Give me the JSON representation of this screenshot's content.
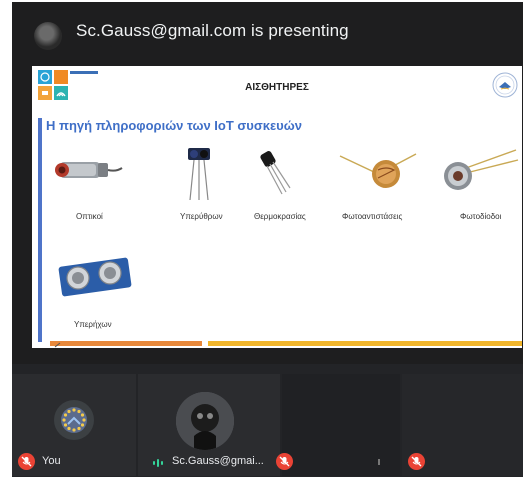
{
  "presenter": {
    "label": "Sc.Gauss@gmail.com is presenting"
  },
  "slide": {
    "title": "ΑΙΣΘΗΤΗΡΕΣ",
    "subtitle": "Η πηγή πληροφοριών των IoT συσκευών",
    "sensors": [
      {
        "label": "Οπτικοί",
        "icon": "optical-sensor-icon"
      },
      {
        "label": "Υπερύθρων",
        "icon": "infrared-sensor-icon"
      },
      {
        "label": "Θερμοκρασίας",
        "icon": "temperature-sensor-icon"
      },
      {
        "label": "Φωτοαντιστάσεις",
        "icon": "photoresistor-icon"
      },
      {
        "label": "Φωτοδίοδοι",
        "icon": "photodiode-icon"
      },
      {
        "label": "Υπερήχων",
        "icon": "ultrasonic-sensor-icon"
      }
    ],
    "colors": {
      "accent": "#3f6fc7",
      "bar_orange": "#e8883a",
      "bar_yellow": "#f2b62b"
    }
  },
  "participants": {
    "you": {
      "name": "You",
      "mic": "muted"
    },
    "gauss": {
      "name": "Sc.Gauss@gmai...",
      "mic": "speaking"
    },
    "p3": {
      "mic": "muted"
    },
    "p4": {
      "mic": "muted"
    }
  },
  "colors": {
    "mute_red": "#ea4335",
    "speaking_green": "#34d399"
  }
}
